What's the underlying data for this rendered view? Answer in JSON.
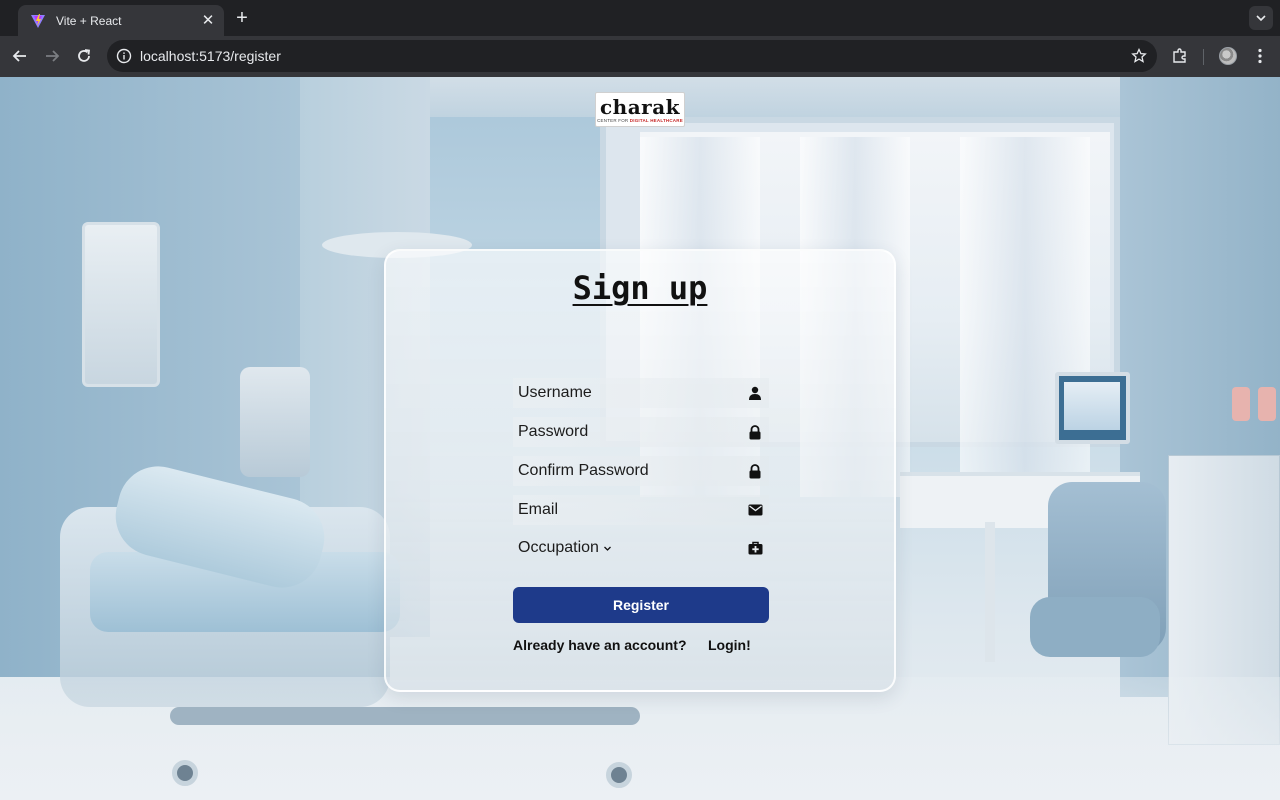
{
  "browser": {
    "tab_title": "Vite + React",
    "url": "localhost:5173/register"
  },
  "logo": {
    "wordmark": "charak",
    "tagline_prefix": "CENTER FOR ",
    "tagline_highlight": "DIGITAL HEALTHCARE"
  },
  "form": {
    "title": "Sign up",
    "fields": [
      {
        "label": "Username",
        "icon": "user-icon"
      },
      {
        "label": "Password",
        "icon": "lock-icon"
      },
      {
        "label": "Confirm Password",
        "icon": "lock-icon"
      },
      {
        "label": "Email",
        "icon": "envelope-icon"
      }
    ],
    "occupation": {
      "label": "Occupation",
      "icon": "briefcase-medical-icon"
    },
    "register_label": "Register",
    "already_text": "Already have an account?",
    "login_label": "Login!"
  },
  "colors": {
    "register_button": "#1e3a8a",
    "browser_frame": "#202124",
    "browser_toolbar": "#35363a"
  }
}
